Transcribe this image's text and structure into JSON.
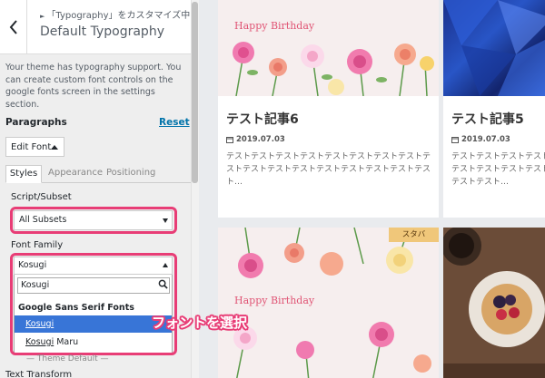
{
  "header": {
    "breadcrumb": "「Typography」をカスタマイズ中",
    "title": "Default Typography"
  },
  "description": "Your theme has typography support. You can create custom font controls on the google fonts screen in the settings section.",
  "paragraphs": {
    "heading": "Paragraphs",
    "reset_label": "Reset",
    "edit_font_label": "Edit Font"
  },
  "tabs": [
    {
      "label": "Styles",
      "active": true
    },
    {
      "label": "Appearance",
      "active": false
    },
    {
      "label": "Positioning",
      "active": false
    }
  ],
  "script_subset": {
    "label": "Script/Subset",
    "value": "All Subsets"
  },
  "font_family": {
    "label": "Font Family",
    "value": "Kosugi",
    "search_value": "Kosugi",
    "group_label": "Google Sans Serif Fonts",
    "options": [
      {
        "label": "Kosugi",
        "highlighted": true
      },
      {
        "label": "Kosugi",
        "suffix": " Maru",
        "highlighted": false
      }
    ]
  },
  "theme_default": "— Theme Default —",
  "text_transform_label": "Text Transform",
  "callout": "フォントを選択",
  "posts": [
    {
      "title": "テスト記事6",
      "date": "2019.07.03",
      "excerpt": "テストテストテストテストテストテストテストテストテストテストテストテストテストテストテストテストテスト…",
      "image_text": "Happy Birthday"
    },
    {
      "title": "テスト記事5",
      "date": "2019.07.03",
      "excerpt": "テストテストテストテストテストテストテストテストテストテスト…"
    },
    {
      "image_text": "Happy Birthday",
      "tag": "スタバ"
    },
    {}
  ],
  "colors": {
    "accent_highlight": "#e83d76",
    "link": "#0073aa",
    "selected_option": "#3875d7"
  },
  "icons": [
    "chevron-left-icon",
    "search-icon",
    "calendar-icon"
  ]
}
